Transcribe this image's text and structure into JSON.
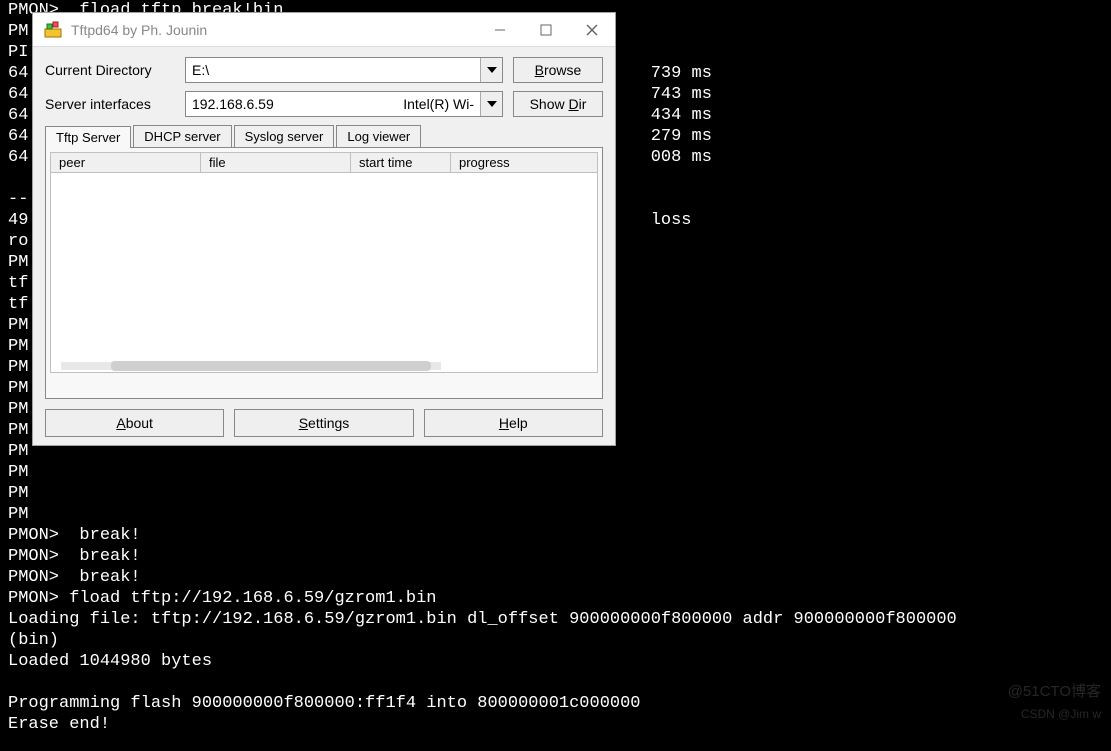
{
  "terminal": {
    "lines": [
      "PMON>  fload tftp break!bin",
      "PM",
      "PI",
      "64                                                             739 ms",
      "64                                                             743 ms",
      "64                                                             434 ms",
      "64                                                             279 ms",
      "64                                                             008 ms",
      "",
      "--",
      "49                                                             loss",
      "ro",
      "PM",
      "tf",
      "tf",
      "PM",
      "PM",
      "PM",
      "PM",
      "PM",
      "PM",
      "PM",
      "PM",
      "PM",
      "PM",
      "PMON>  break!",
      "PMON>  break!",
      "PMON>  break!",
      "PMON> fload tftp://192.168.6.59/gzrom1.bin",
      "Loading file: tftp://192.168.6.59/gzrom1.bin dl_offset 900000000f800000 addr 900000000f800000",
      "(bin)",
      "Loaded 1044980 bytes",
      "",
      "Programming flash 900000000f800000:ff1f4 into 800000001c000000",
      "Erase end!"
    ]
  },
  "window": {
    "title": "Tftpd64 by Ph. Jounin",
    "labels": {
      "current_dir": "Current Directory",
      "server_if": "Server interfaces"
    },
    "current_dir_value": "E:\\",
    "server_if_ip": "192.168.6.59",
    "server_if_desc": "Intel(R) Wi-",
    "buttons": {
      "browse": "Browse",
      "showdir": "Show Dir",
      "about": "About",
      "settings": "Settings",
      "help": "Help"
    },
    "tabs": [
      "Tftp Server",
      "DHCP server",
      "Syslog server",
      "Log viewer"
    ],
    "active_tab": 0,
    "columns": {
      "peer": "peer",
      "file": "file",
      "start": "start time",
      "progress": "progress"
    }
  },
  "watermark": "@51CTO博客",
  "watermark2": "CSDN @Jim w"
}
